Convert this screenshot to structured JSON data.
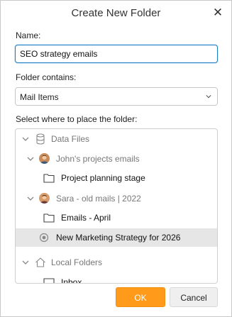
{
  "dialog": {
    "title": "Create New Folder",
    "close_icon": "close-icon"
  },
  "name_field": {
    "label": "Name:",
    "value": "SEO strategy emails"
  },
  "contains_field": {
    "label": "Folder contains:",
    "value": "Mail Items"
  },
  "tree": {
    "label": "Select where to place the folder:",
    "items": [
      {
        "label": "Data Files",
        "icon": "database-icon"
      },
      {
        "label": "John's projects emails",
        "icon": "avatar-icon"
      },
      {
        "label": "Project planning stage",
        "icon": "folder-icon"
      },
      {
        "label": "Sara - old mails | 2022",
        "icon": "avatar-icon"
      },
      {
        "label": "Emails - April",
        "icon": "folder-icon"
      },
      {
        "label": "New Marketing Strategy for 2026",
        "icon": "radio-icon",
        "selected": true
      },
      {
        "label": "Local Folders",
        "icon": "home-icon"
      },
      {
        "label": "Inbox",
        "icon": "inbox-icon"
      }
    ]
  },
  "buttons": {
    "ok": "OK",
    "cancel": "Cancel"
  },
  "colors": {
    "accent": "#ff9a1a",
    "focus_border": "#1a7dc4",
    "selected_row": "#e6e6e6"
  }
}
